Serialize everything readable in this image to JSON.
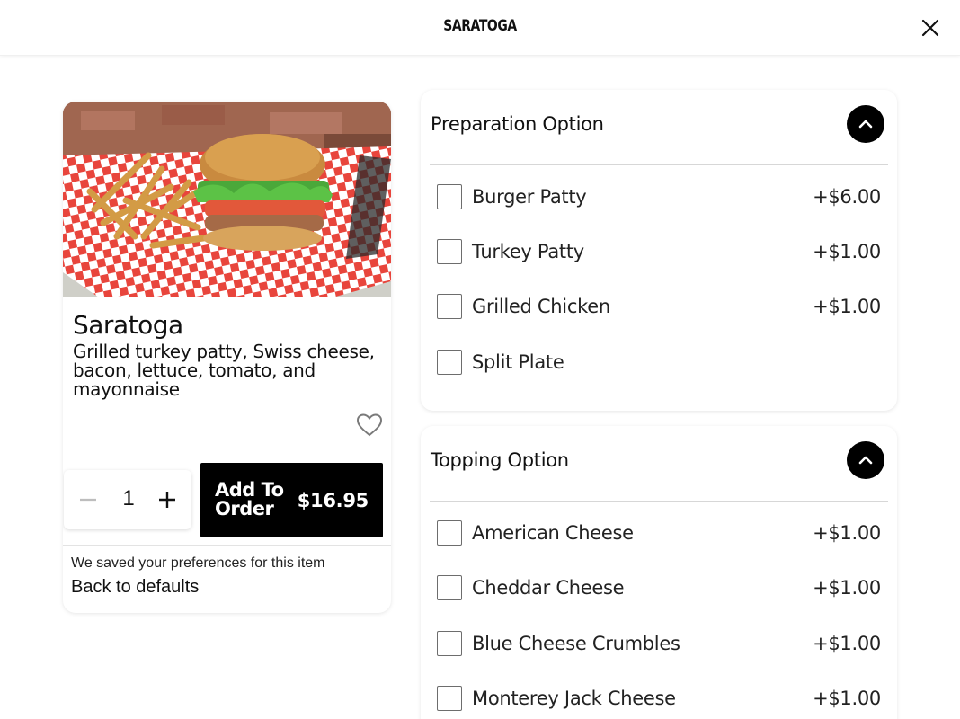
{
  "header": {
    "title": "SARATOGA"
  },
  "item": {
    "name": "Saratoga",
    "description": "Grilled turkey patty, Swiss cheese, bacon, lettuce, tomato, and mayonnaise",
    "quantity": "1",
    "add_label": "Add To Order",
    "price": "$16.95",
    "saved_note": "We saved your preferences for this item",
    "back_link": "Back to defaults"
  },
  "preparation": {
    "title": "Preparation Option",
    "options": [
      {
        "label": "Burger Patty",
        "price": "+$6.00"
      },
      {
        "label": "Turkey Patty",
        "price": "+$1.00"
      },
      {
        "label": "Grilled Chicken",
        "price": "+$1.00"
      },
      {
        "label": "Split Plate",
        "price": ""
      }
    ]
  },
  "topping": {
    "title": "Topping Option",
    "options": [
      {
        "label": "American Cheese",
        "price": "+$1.00"
      },
      {
        "label": "Cheddar Cheese",
        "price": "+$1.00"
      },
      {
        "label": "Blue Cheese Crumbles",
        "price": "+$1.00"
      },
      {
        "label": "Monterey Jack Cheese",
        "price": "+$1.00"
      }
    ]
  },
  "icons": {
    "close": "close-icon",
    "heart": "heart-icon",
    "minus": "minus-icon",
    "plus": "plus-icon",
    "chevron": "chevron-up-icon"
  },
  "colors": {
    "accent": "#000000",
    "checkered": "#e8453c"
  }
}
